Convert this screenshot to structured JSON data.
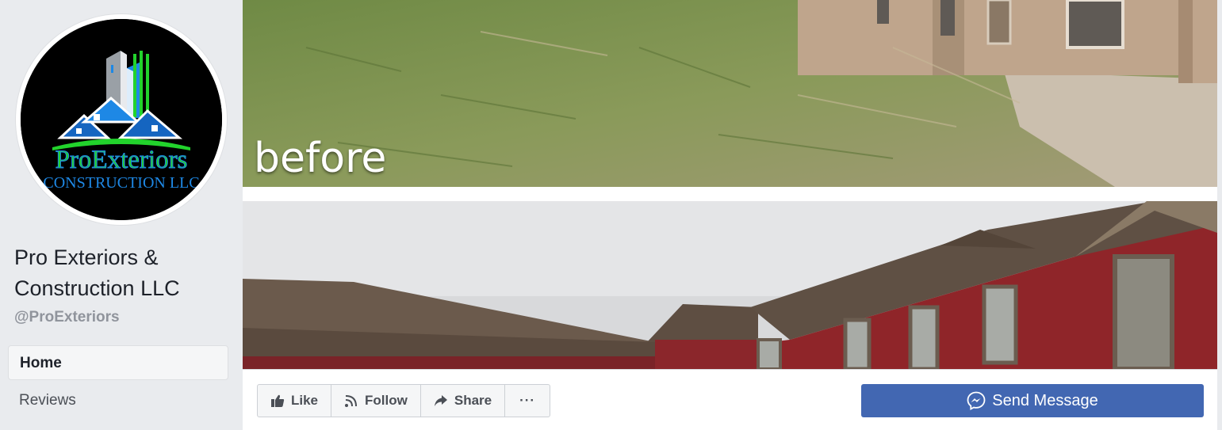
{
  "page": {
    "name": "Pro Exteriors & Construction LLC",
    "handle": "@ProExteriors",
    "logo_text": {
      "line1": "ProExteriors",
      "line2": "CONSTRUCTION LLC"
    }
  },
  "nav": {
    "items": [
      {
        "label": "Home",
        "active": true
      },
      {
        "label": "Reviews",
        "active": false
      }
    ]
  },
  "cover": {
    "before_label": "before"
  },
  "actions": {
    "like_label": "Like",
    "follow_label": "Follow",
    "share_label": "Share",
    "more_label": "···",
    "send_message_label": "Send Message"
  },
  "icons": {
    "like": "thumbs-up-icon",
    "follow": "rss-feed-icon",
    "share": "share-arrow-icon",
    "messenger": "messenger-icon"
  },
  "colors": {
    "brand_blue": "#4267b2",
    "logo_green": "#22d32c",
    "logo_blue": "#1e88e5"
  }
}
